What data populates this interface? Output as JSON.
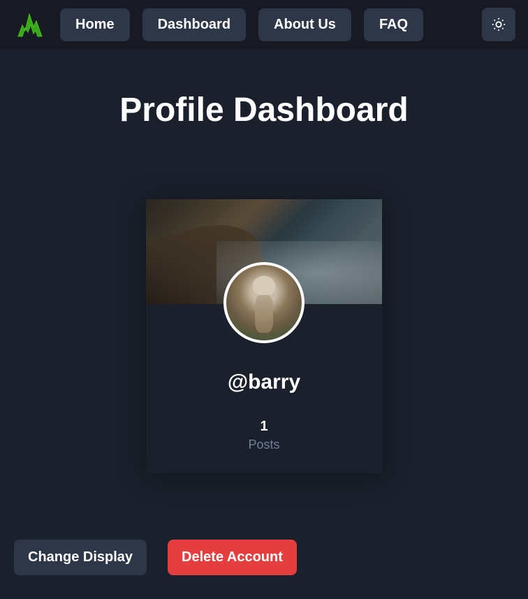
{
  "nav": {
    "home": "Home",
    "dashboard": "Dashboard",
    "about": "About Us",
    "faq": "FAQ"
  },
  "page": {
    "title": "Profile Dashboard"
  },
  "profile": {
    "username": "@barry",
    "posts_count": "1",
    "posts_label": "Posts"
  },
  "actions": {
    "change_display": "Change Display",
    "delete_account": "Delete Account"
  }
}
